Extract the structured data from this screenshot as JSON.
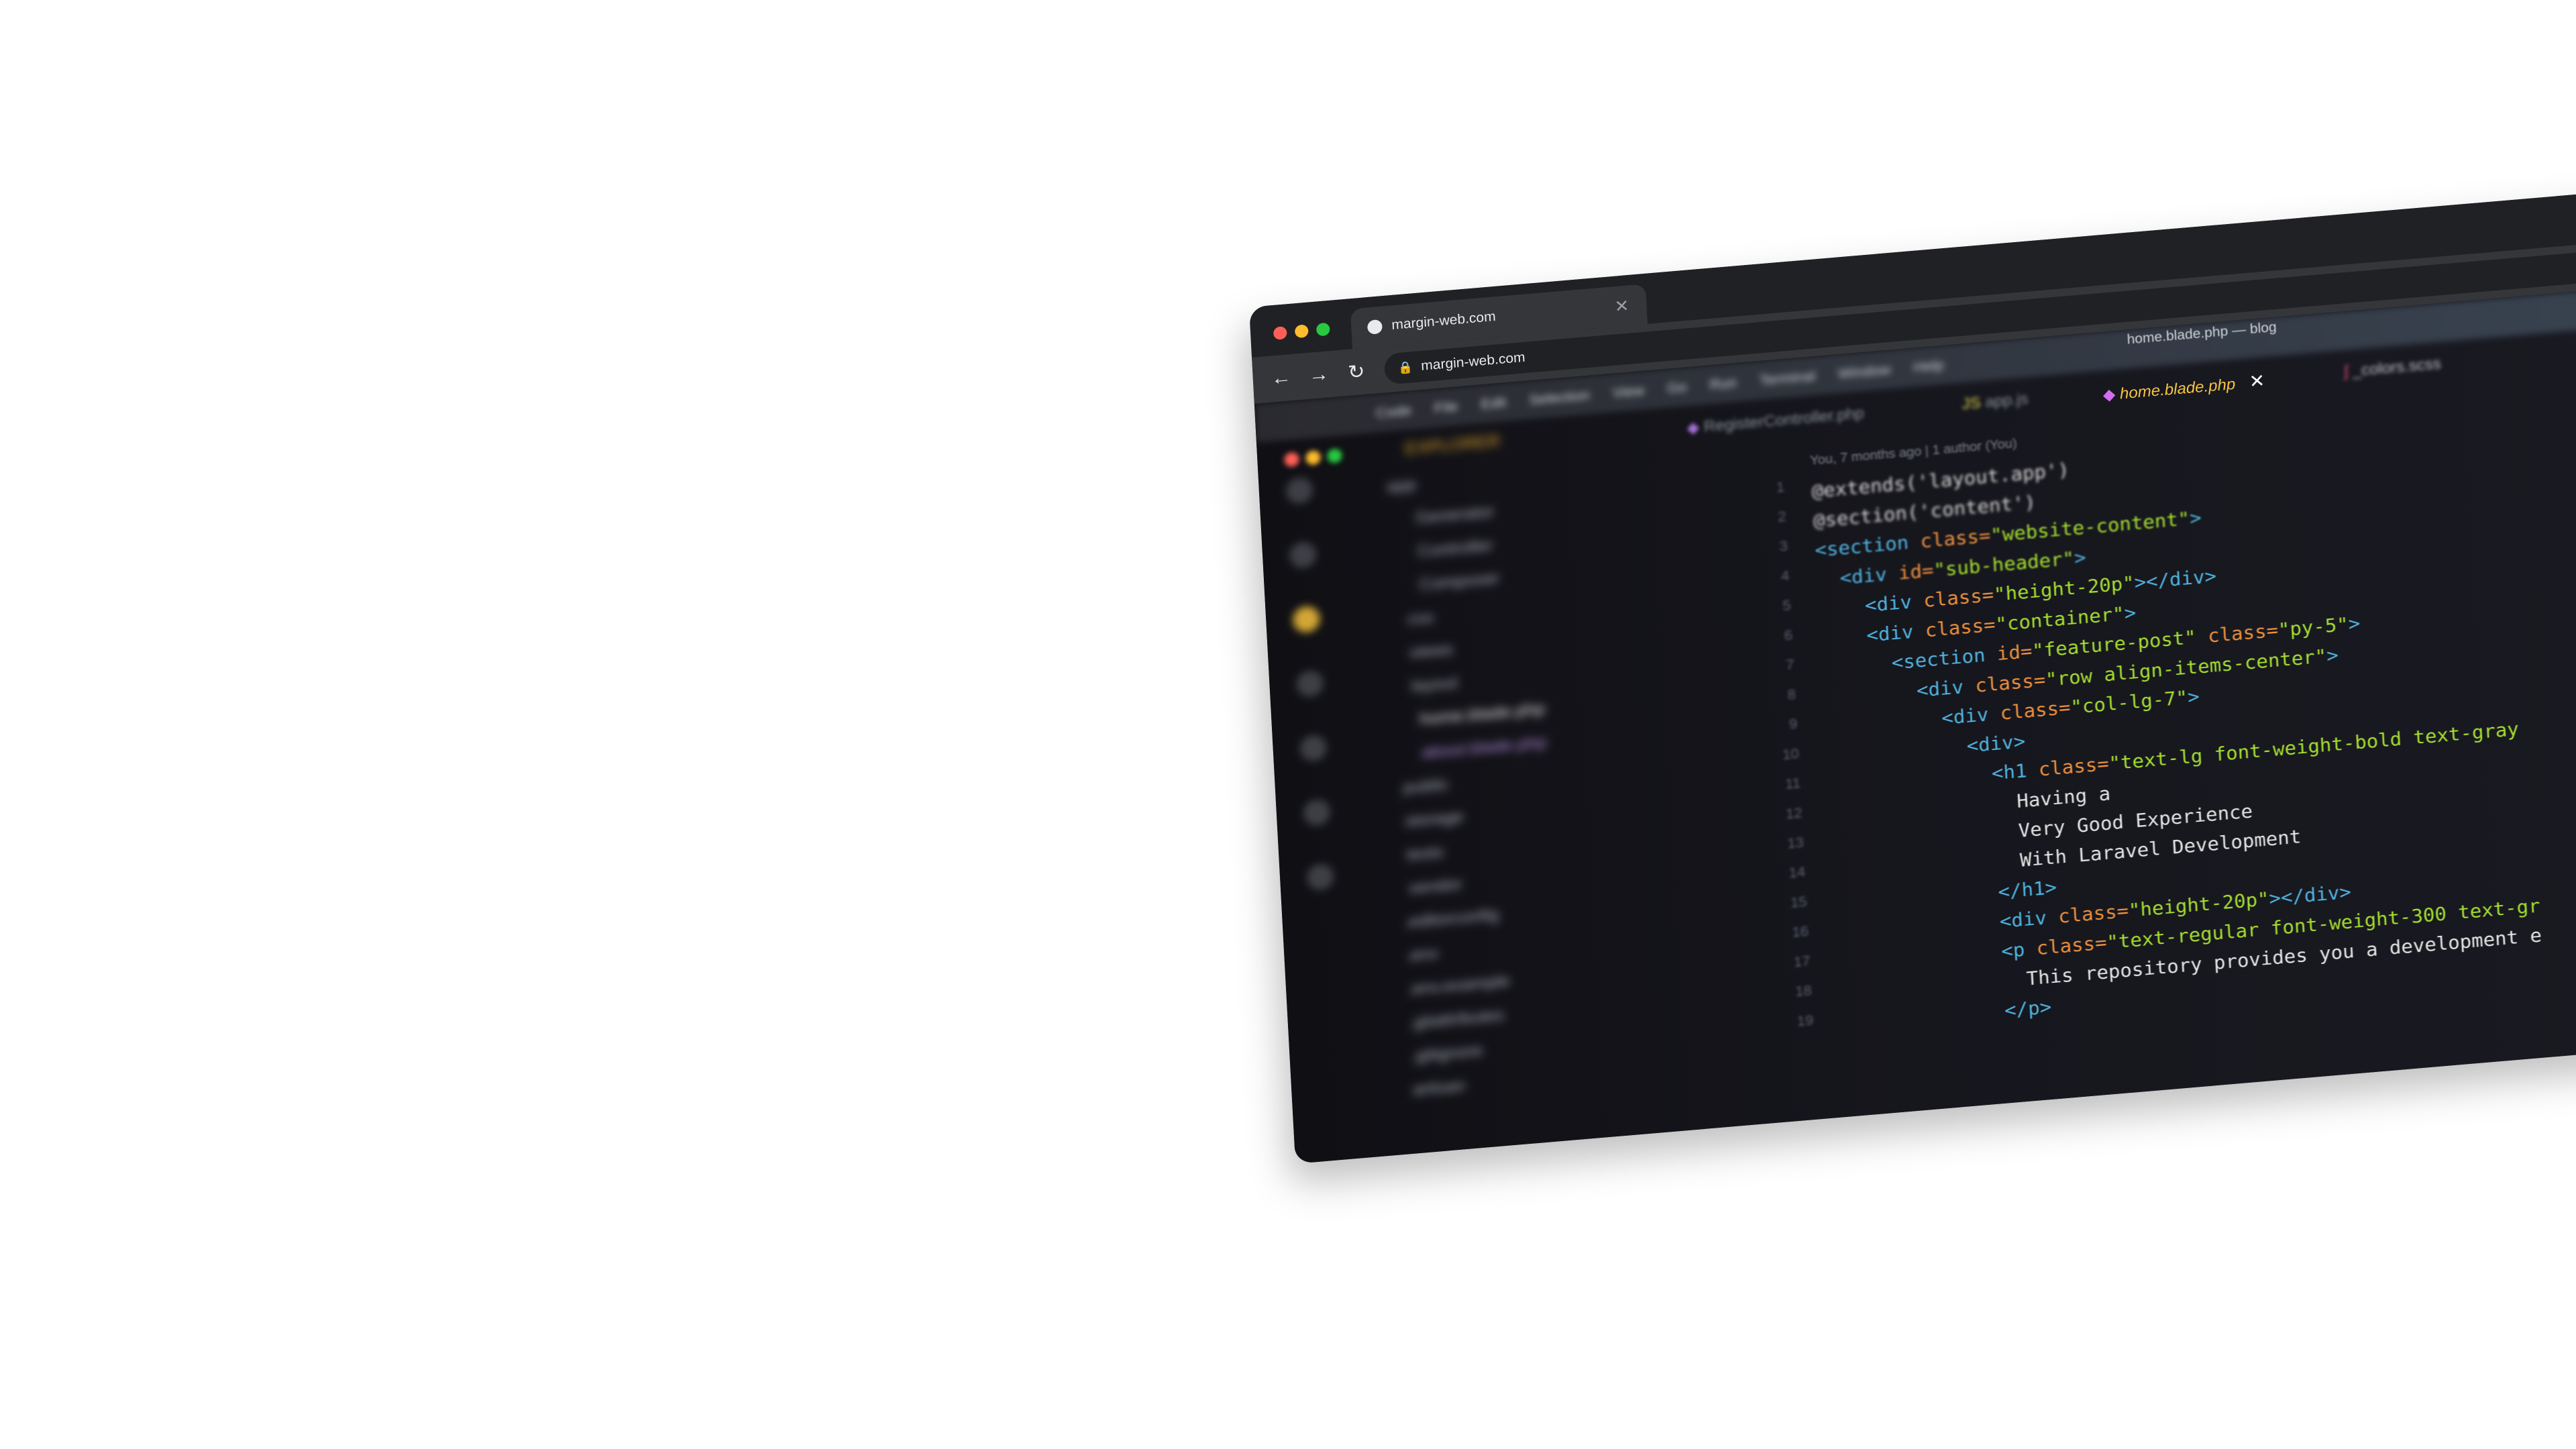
{
  "browser": {
    "tab_title": "margin-web.com",
    "url": "margin-web.com",
    "back_glyph": "←",
    "forward_glyph": "→",
    "reload_glyph": "↻",
    "close_glyph": "✕",
    "lock_glyph": "🔒"
  },
  "vscode": {
    "window_title": "home.blade.php — blog",
    "menu": [
      "Code",
      "File",
      "Edit",
      "Selection",
      "View",
      "Go",
      "Run",
      "Terminal",
      "Window",
      "Help"
    ],
    "explorer_header": "EXPLORER",
    "tree": [
      "app",
      "Generator",
      "Controller",
      "Composer",
      "css",
      "views",
      "layout",
      "home.blade.php",
      "about.blade.php",
      "public",
      "storage",
      "tests",
      "vendor",
      ".editorconfig",
      ".env",
      ".env.example",
      ".gitattributes",
      ".gitignore",
      "artisan"
    ],
    "tabs": [
      {
        "label": "RegisterController.php",
        "icon": "php-icon",
        "active": false
      },
      {
        "label": "app.js",
        "icon": "js-icon",
        "active": false
      },
      {
        "label": "home.blade.php",
        "icon": "blade-icon",
        "active": true
      },
      {
        "label": "_colors.scss",
        "icon": "sass-icon",
        "active": false
      }
    ],
    "blame": "You, 7 months ago | 1 author (You)",
    "line_numbers": [
      "1",
      "2",
      "3",
      "4",
      "5",
      "6",
      "7",
      "8",
      "9",
      "10",
      "11",
      "12",
      "13",
      "14",
      "15",
      "16",
      "17",
      "18",
      "19"
    ]
  },
  "code": [
    [
      [
        "@extends('layout.app')",
        "c-blade"
      ]
    ],
    [
      [
        "@section('content')",
        "c-blade"
      ]
    ],
    [
      [
        "<section ",
        "c-tag"
      ],
      [
        "class=",
        "c-attr"
      ],
      [
        "\"website-content\"",
        "c-str"
      ],
      [
        ">",
        "c-tag"
      ]
    ],
    [
      [
        "  <div ",
        "c-tag"
      ],
      [
        "id=",
        "c-attr"
      ],
      [
        "\"sub-header\"",
        "c-str"
      ],
      [
        ">",
        "c-tag"
      ]
    ],
    [
      [
        "    <div ",
        "c-tag"
      ],
      [
        "class=",
        "c-attr"
      ],
      [
        "\"height-20p\"",
        "c-str"
      ],
      [
        "></div>",
        "c-tag"
      ]
    ],
    [
      [
        "    <div ",
        "c-tag"
      ],
      [
        "class=",
        "c-attr"
      ],
      [
        "\"container\"",
        "c-str"
      ],
      [
        ">",
        "c-tag"
      ]
    ],
    [
      [
        "      <section ",
        "c-tag"
      ],
      [
        "id=",
        "c-attr"
      ],
      [
        "\"feature-post\" ",
        "c-str"
      ],
      [
        "class=",
        "c-attr"
      ],
      [
        "\"py-5\"",
        "c-str"
      ],
      [
        ">",
        "c-tag"
      ]
    ],
    [
      [
        "        <div ",
        "c-tag"
      ],
      [
        "class=",
        "c-attr"
      ],
      [
        "\"row align-items-center\"",
        "c-str"
      ],
      [
        ">",
        "c-tag"
      ]
    ],
    [
      [
        "          <div ",
        "c-tag"
      ],
      [
        "class=",
        "c-attr"
      ],
      [
        "\"col-lg-7\"",
        "c-str"
      ],
      [
        ">",
        "c-tag"
      ]
    ],
    [
      [
        "            <div>",
        "c-tag"
      ]
    ],
    [
      [
        "              <h1 ",
        "c-tag"
      ],
      [
        "class=",
        "c-attr"
      ],
      [
        "\"text-lg font-weight-bold text-gray",
        "c-str"
      ]
    ],
    [
      [
        "                Having a",
        "c-text"
      ]
    ],
    [
      [
        "                Very Good Experience",
        "c-text"
      ]
    ],
    [
      [
        "                With Laravel Development",
        "c-text"
      ]
    ],
    [
      [
        "              </h1>",
        "c-tag"
      ]
    ],
    [
      [
        "              <div ",
        "c-tag"
      ],
      [
        "class=",
        "c-attr"
      ],
      [
        "\"height-20p\"",
        "c-str"
      ],
      [
        "></div>",
        "c-tag"
      ]
    ],
    [
      [
        "              <p ",
        "c-tag"
      ],
      [
        "class=",
        "c-attr"
      ],
      [
        "\"text-regular font-weight-300 text-gr",
        "c-str"
      ]
    ],
    [
      [
        "                This repository provides you a development e",
        "c-text"
      ]
    ],
    [
      [
        "              </p>",
        "c-tag"
      ]
    ]
  ],
  "colors": {
    "tag": "#4fb6e3",
    "attr": "#f0923c",
    "string": "#a6e22e",
    "active_tab": "#f5c542"
  }
}
